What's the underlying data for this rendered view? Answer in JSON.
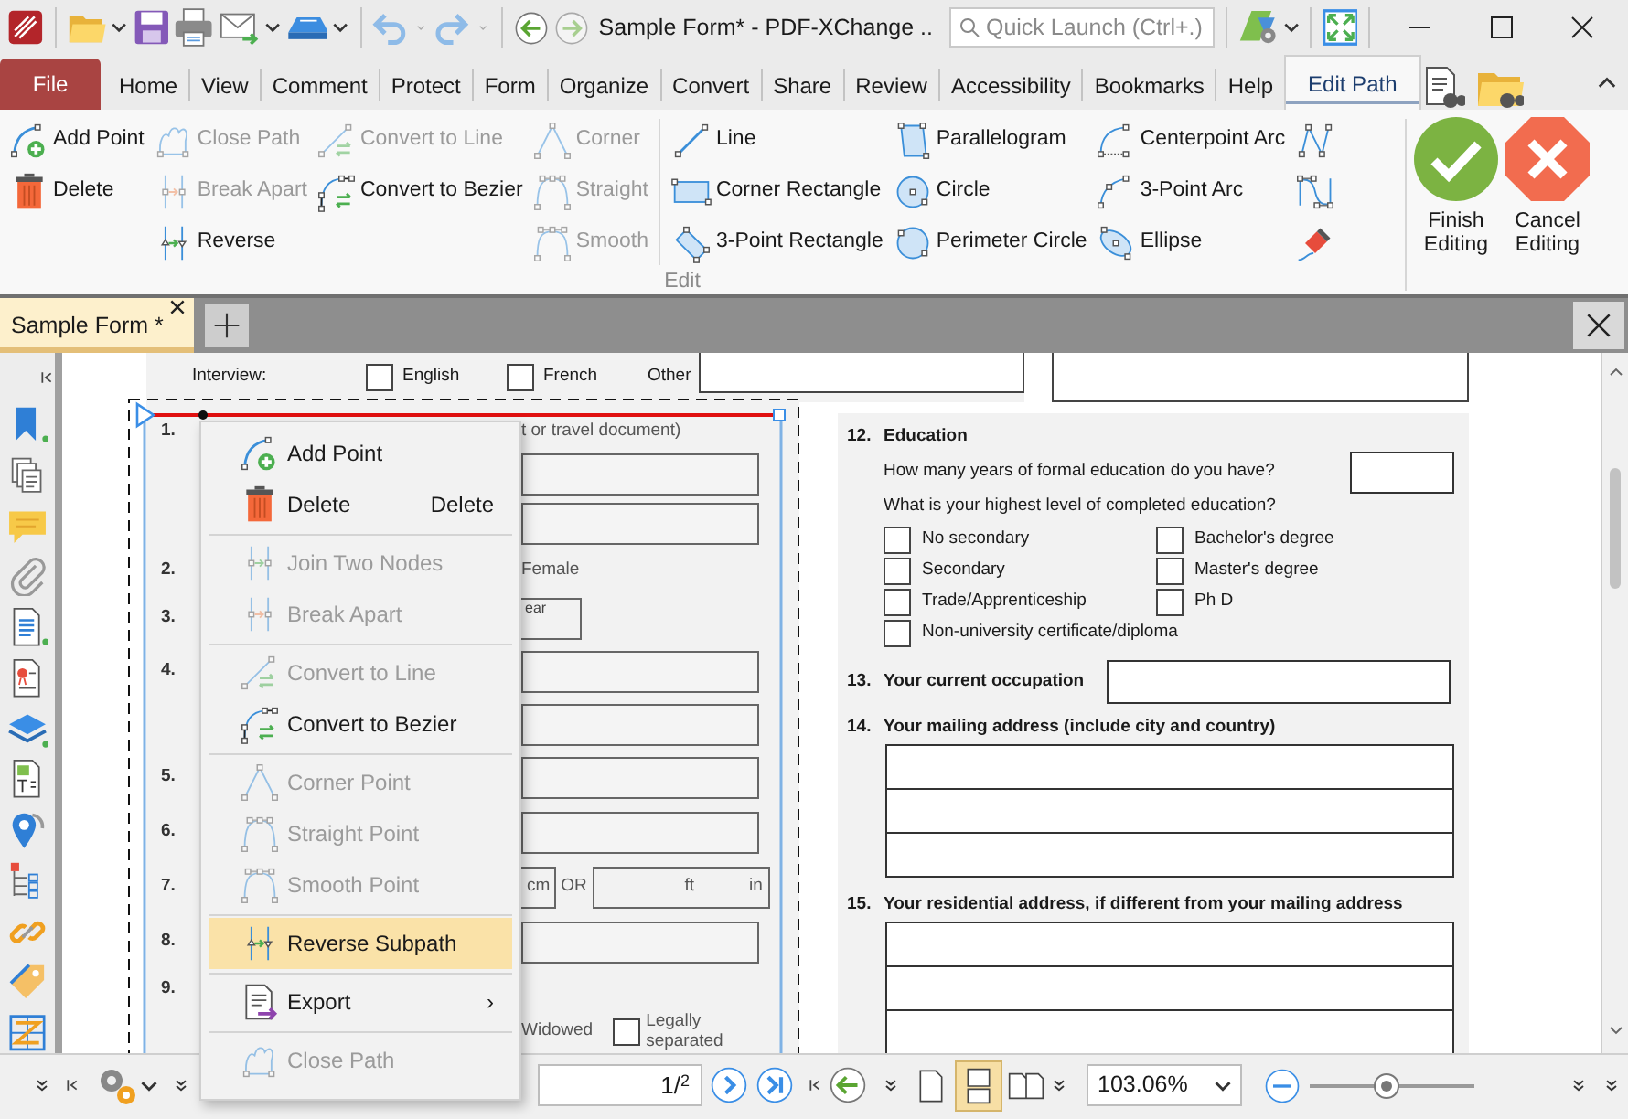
{
  "title_bar": {
    "title": "Sample Form* - PDF-XChange ..",
    "quick_launch": {
      "placeholder": "Quick Launch (Ctrl+.)"
    }
  },
  "menu_tabs": [
    {
      "label": "File",
      "kind": "file",
      "selected": false
    },
    {
      "label": "Home",
      "kind": "tab",
      "selected": false
    },
    {
      "label": "View",
      "kind": "tab",
      "selected": false
    },
    {
      "label": "Comment",
      "kind": "tab",
      "selected": false
    },
    {
      "label": "Protect",
      "kind": "tab",
      "selected": false
    },
    {
      "label": "Form",
      "kind": "tab",
      "selected": false
    },
    {
      "label": "Organize",
      "kind": "tab",
      "selected": false
    },
    {
      "label": "Convert",
      "kind": "tab",
      "selected": false
    },
    {
      "label": "Share",
      "kind": "tab",
      "selected": false
    },
    {
      "label": "Review",
      "kind": "tab",
      "selected": false
    },
    {
      "label": "Accessibility",
      "kind": "tab",
      "selected": false
    },
    {
      "label": "Bookmarks",
      "kind": "tab",
      "selected": false
    },
    {
      "label": "Help",
      "kind": "tab",
      "selected": false
    },
    {
      "label": "Edit Path",
      "kind": "tab",
      "selected": true
    }
  ],
  "ribbon": {
    "columns": [
      [
        {
          "label": "Add Point",
          "disabled": false
        },
        {
          "label": "Delete",
          "disabled": false
        }
      ],
      [
        {
          "label": "Close Path",
          "disabled": true
        },
        {
          "label": "Break Apart",
          "disabled": true
        },
        {
          "label": "Reverse",
          "disabled": false
        }
      ],
      [
        {
          "label": "Convert to Line",
          "disabled": true
        },
        {
          "label": "Convert to Bezier",
          "disabled": false
        }
      ],
      [
        {
          "label": "Corner",
          "disabled": true
        },
        {
          "label": "Straight",
          "disabled": true
        },
        {
          "label": "Smooth",
          "disabled": true
        }
      ],
      [
        {
          "label": "Line",
          "disabled": false
        },
        {
          "label": "Corner Rectangle",
          "disabled": false
        },
        {
          "label": "3-Point Rectangle",
          "disabled": false
        }
      ],
      [
        {
          "label": "Parallelogram",
          "disabled": false
        },
        {
          "label": "Circle",
          "disabled": false
        },
        {
          "label": "Perimeter Circle",
          "disabled": false
        }
      ],
      [
        {
          "label": "Centerpoint Arc",
          "disabled": false
        },
        {
          "label": "3-Point Arc",
          "disabled": false
        },
        {
          "label": "Ellipse",
          "disabled": false
        }
      ]
    ],
    "group_label": "Edit",
    "actions": [
      {
        "label": "Finish Editing",
        "kind": "finish"
      },
      {
        "label": "Cancel Editing",
        "kind": "cancel"
      }
    ]
  },
  "doc_tabs": [
    {
      "label": "Sample Form *",
      "selected": true
    }
  ],
  "form": {
    "interview": {
      "label": "Interview:",
      "options": [
        {
          "label": "English",
          "checked": false
        },
        {
          "label": "French",
          "checked": false
        }
      ],
      "other_label": "Other"
    },
    "left_rows": [
      {
        "number": "1.",
        "items": [
          {
            "kind": "text",
            "text": "t or travel document)"
          }
        ]
      },
      {
        "items": [
          {
            "kind": "field"
          }
        ]
      },
      {
        "items": [
          {
            "kind": "field"
          }
        ]
      },
      {
        "number": "2.",
        "items": [
          {
            "kind": "text",
            "text": "Female"
          }
        ]
      },
      {
        "number": "3.",
        "items": [
          {
            "kind": "small_field",
            "text": "ear"
          }
        ]
      },
      {
        "number": "4.",
        "items": [
          {
            "kind": "field"
          }
        ]
      },
      {
        "items": [
          {
            "kind": "field"
          }
        ]
      },
      {
        "number": "5.",
        "items": [
          {
            "kind": "field"
          }
        ]
      },
      {
        "number": "6.",
        "items": [
          {
            "kind": "field"
          }
        ]
      },
      {
        "number": "7.",
        "items": [
          {
            "kind": "unit_field",
            "units": [
              "cm"
            ]
          },
          {
            "kind": "text",
            "text": "OR"
          },
          {
            "kind": "unit_field",
            "units": [
              "ft",
              "in"
            ]
          }
        ]
      },
      {
        "number": "8.",
        "items": [
          {
            "kind": "field"
          }
        ]
      },
      {
        "number": "9."
      },
      {
        "items": [
          {
            "kind": "text",
            "text": "Widowed"
          },
          {
            "kind": "checkbox",
            "checked": false
          },
          {
            "kind": "text",
            "text": "Legally separated"
          }
        ]
      }
    ],
    "education": {
      "number": "12.",
      "title": "Education",
      "question_1": "How many years of formal education do you have?",
      "question_2": "What is your highest level of completed education?",
      "options": [
        {
          "label": "No secondary",
          "checked": false
        },
        {
          "label": "Bachelor's degree",
          "checked": false
        },
        {
          "label": "Secondary",
          "checked": false
        },
        {
          "label": "Master's degree",
          "checked": false
        },
        {
          "label": "Trade/Apprenticeship",
          "checked": false
        },
        {
          "label": "Ph D",
          "checked": false
        },
        {
          "label": "Non-university certificate/diploma",
          "checked": false
        }
      ]
    },
    "occupation": {
      "number": "13.",
      "label": "Your current occupation"
    },
    "addresses": [
      {
        "number": "14.",
        "label": "Your mailing address (include city and country)"
      },
      {
        "number": "15.",
        "label": "Your residential address, if different from your mailing address"
      }
    ]
  },
  "context_menu": {
    "items": [
      {
        "kind": "item",
        "label": "Add Point",
        "disabled": false,
        "selected": false
      },
      {
        "kind": "item",
        "label": "Delete",
        "shortcut": "Delete",
        "disabled": false,
        "selected": false
      },
      {
        "kind": "separator"
      },
      {
        "kind": "item",
        "label": "Join Two Nodes",
        "disabled": true,
        "selected": false
      },
      {
        "kind": "item",
        "label": "Break Apart",
        "disabled": true,
        "selected": false
      },
      {
        "kind": "separator"
      },
      {
        "kind": "item",
        "label": "Convert to Line",
        "disabled": true,
        "selected": false
      },
      {
        "kind": "item",
        "label": "Convert to Bezier",
        "disabled": false,
        "selected": false
      },
      {
        "kind": "separator"
      },
      {
        "kind": "item",
        "label": "Corner Point",
        "disabled": true,
        "selected": false
      },
      {
        "kind": "item",
        "label": "Straight Point",
        "disabled": true,
        "selected": false
      },
      {
        "kind": "item",
        "label": "Smooth Point",
        "disabled": true,
        "selected": false
      },
      {
        "kind": "separator"
      },
      {
        "kind": "item",
        "label": "Reverse Subpath",
        "disabled": false,
        "selected": true
      },
      {
        "kind": "separator"
      },
      {
        "kind": "submenu",
        "label": "Export",
        "arrow": "›",
        "disabled": false,
        "selected": false
      },
      {
        "kind": "separator"
      },
      {
        "kind": "item",
        "label": "Close Path",
        "disabled": true,
        "selected": false
      }
    ]
  },
  "status_bar": {
    "page": "1/$^{2}$",
    "layout_buttons": [
      {
        "selected": false
      },
      {
        "selected": true
      },
      {
        "selected": false
      }
    ],
    "zoom": "103.06%",
    "zoom_slider": {
      "level": 0.47
    }
  }
}
